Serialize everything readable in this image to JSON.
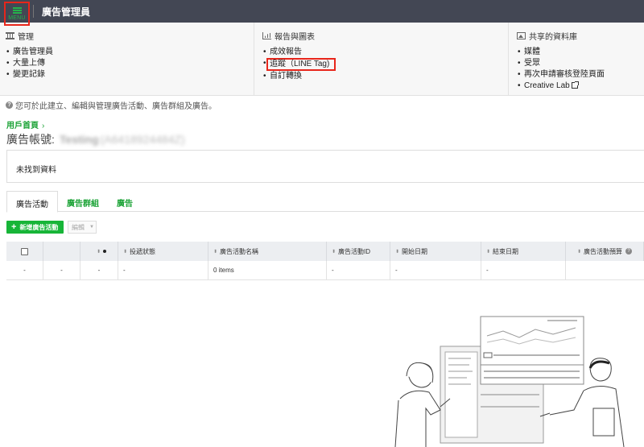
{
  "topbar": {
    "menu_label": "MENU",
    "title": "廣告管理員"
  },
  "menu": {
    "manage": {
      "heading": "管理",
      "items": [
        "廣告管理員",
        "大量上傳",
        "變更記錄"
      ]
    },
    "reports": {
      "heading": "報告與圖表",
      "items": [
        "成效報告",
        "追蹤（LINE Tag)",
        "自訂轉換"
      ]
    },
    "library": {
      "heading": "共享的資料庫",
      "items": [
        "媒體",
        "受眾",
        "再次申請審核登陸頁面",
        "Creative Lab"
      ]
    }
  },
  "help_text": "您可於此建立、編輯與管理廣告活動、廣告群組及廣告。",
  "breadcrumb": {
    "home": "用戶首頁",
    "sep": "›"
  },
  "account": {
    "label": "廣告帳號:",
    "name": "Testing",
    "id": "(A6418924484Z)"
  },
  "nodata": "未找到資料",
  "tabs": [
    "廣告活動",
    "廣告群組",
    "廣告"
  ],
  "toolbar": {
    "add_label": "新增廣告活動",
    "edit_label": "編輯"
  },
  "table": {
    "headers": [
      "",
      "",
      "",
      "投遞狀態",
      "廣告活動名稱",
      "廣告活動ID",
      "開始日期",
      "結束日期",
      "廣告活動預算"
    ],
    "row": [
      "-",
      "-",
      "-",
      "-",
      "0 items",
      "-",
      "-",
      "-",
      ""
    ]
  },
  "colors": {
    "topbar": "#434754",
    "accent_green": "#17b538",
    "highlight_red": "#e8261b"
  }
}
